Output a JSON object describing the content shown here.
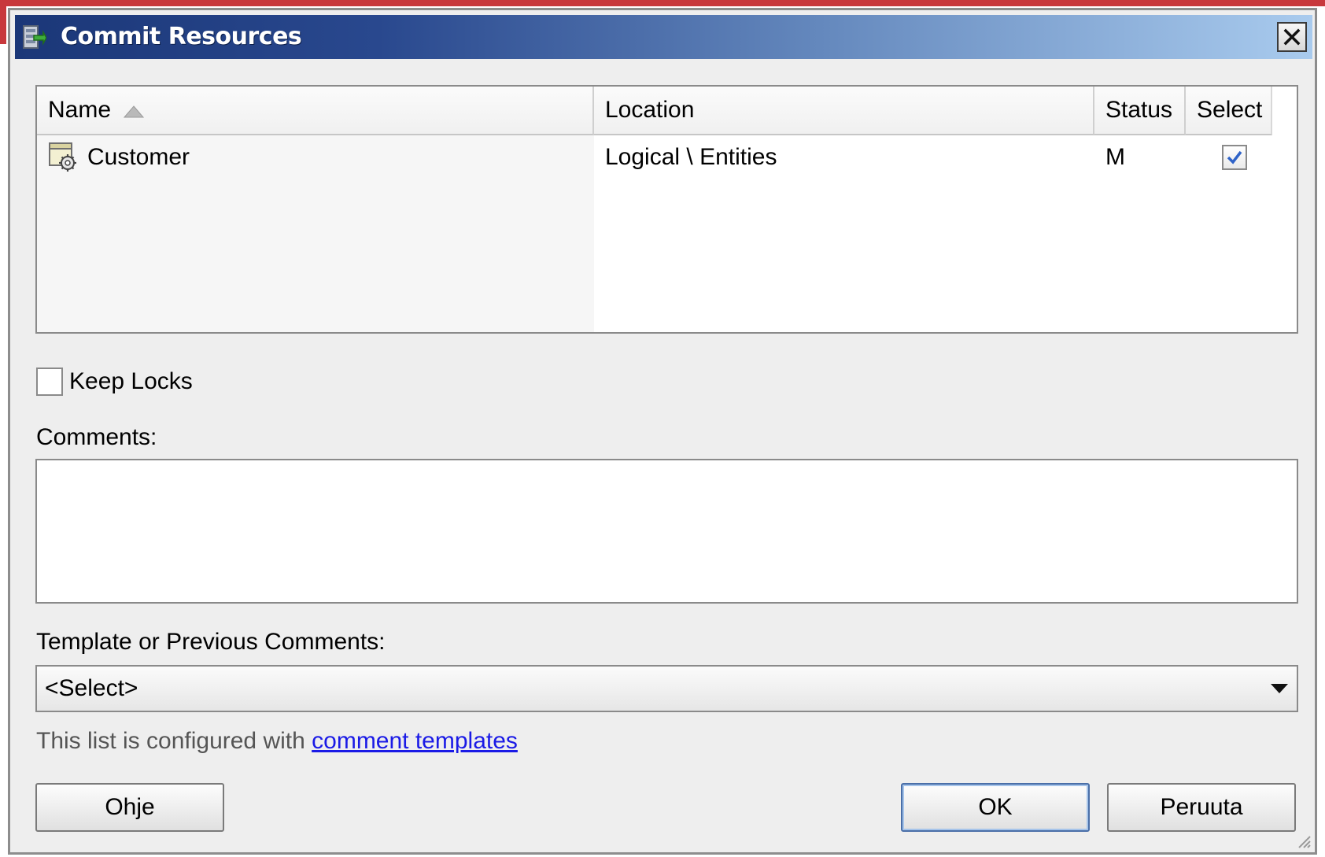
{
  "window": {
    "title": "Commit Resources",
    "title_bar_colors": [
      "#1b3778",
      "#a9cbee"
    ]
  },
  "table": {
    "columns": [
      {
        "label": "Name",
        "sorted": "ascending"
      },
      {
        "label": "Location"
      },
      {
        "label": "Status"
      },
      {
        "label": "Select"
      }
    ],
    "rows": [
      {
        "icon": "entity-gear-icon",
        "name": "Customer",
        "location": "Logical \\ Entities",
        "status": "M",
        "selected": true
      }
    ]
  },
  "keep_locks": {
    "label": "Keep Locks",
    "checked": false
  },
  "comments": {
    "label": "Comments:",
    "value": ""
  },
  "template": {
    "label": "Template or Previous Comments:",
    "selected": "<Select>"
  },
  "hint": {
    "text": "This list is configured with ",
    "link": "comment templates"
  },
  "buttons": {
    "help": "Ohje",
    "ok": "OK",
    "cancel": "Peruuta"
  },
  "colors": {
    "link": "#1a1ae6",
    "check": "#2f63c8"
  }
}
